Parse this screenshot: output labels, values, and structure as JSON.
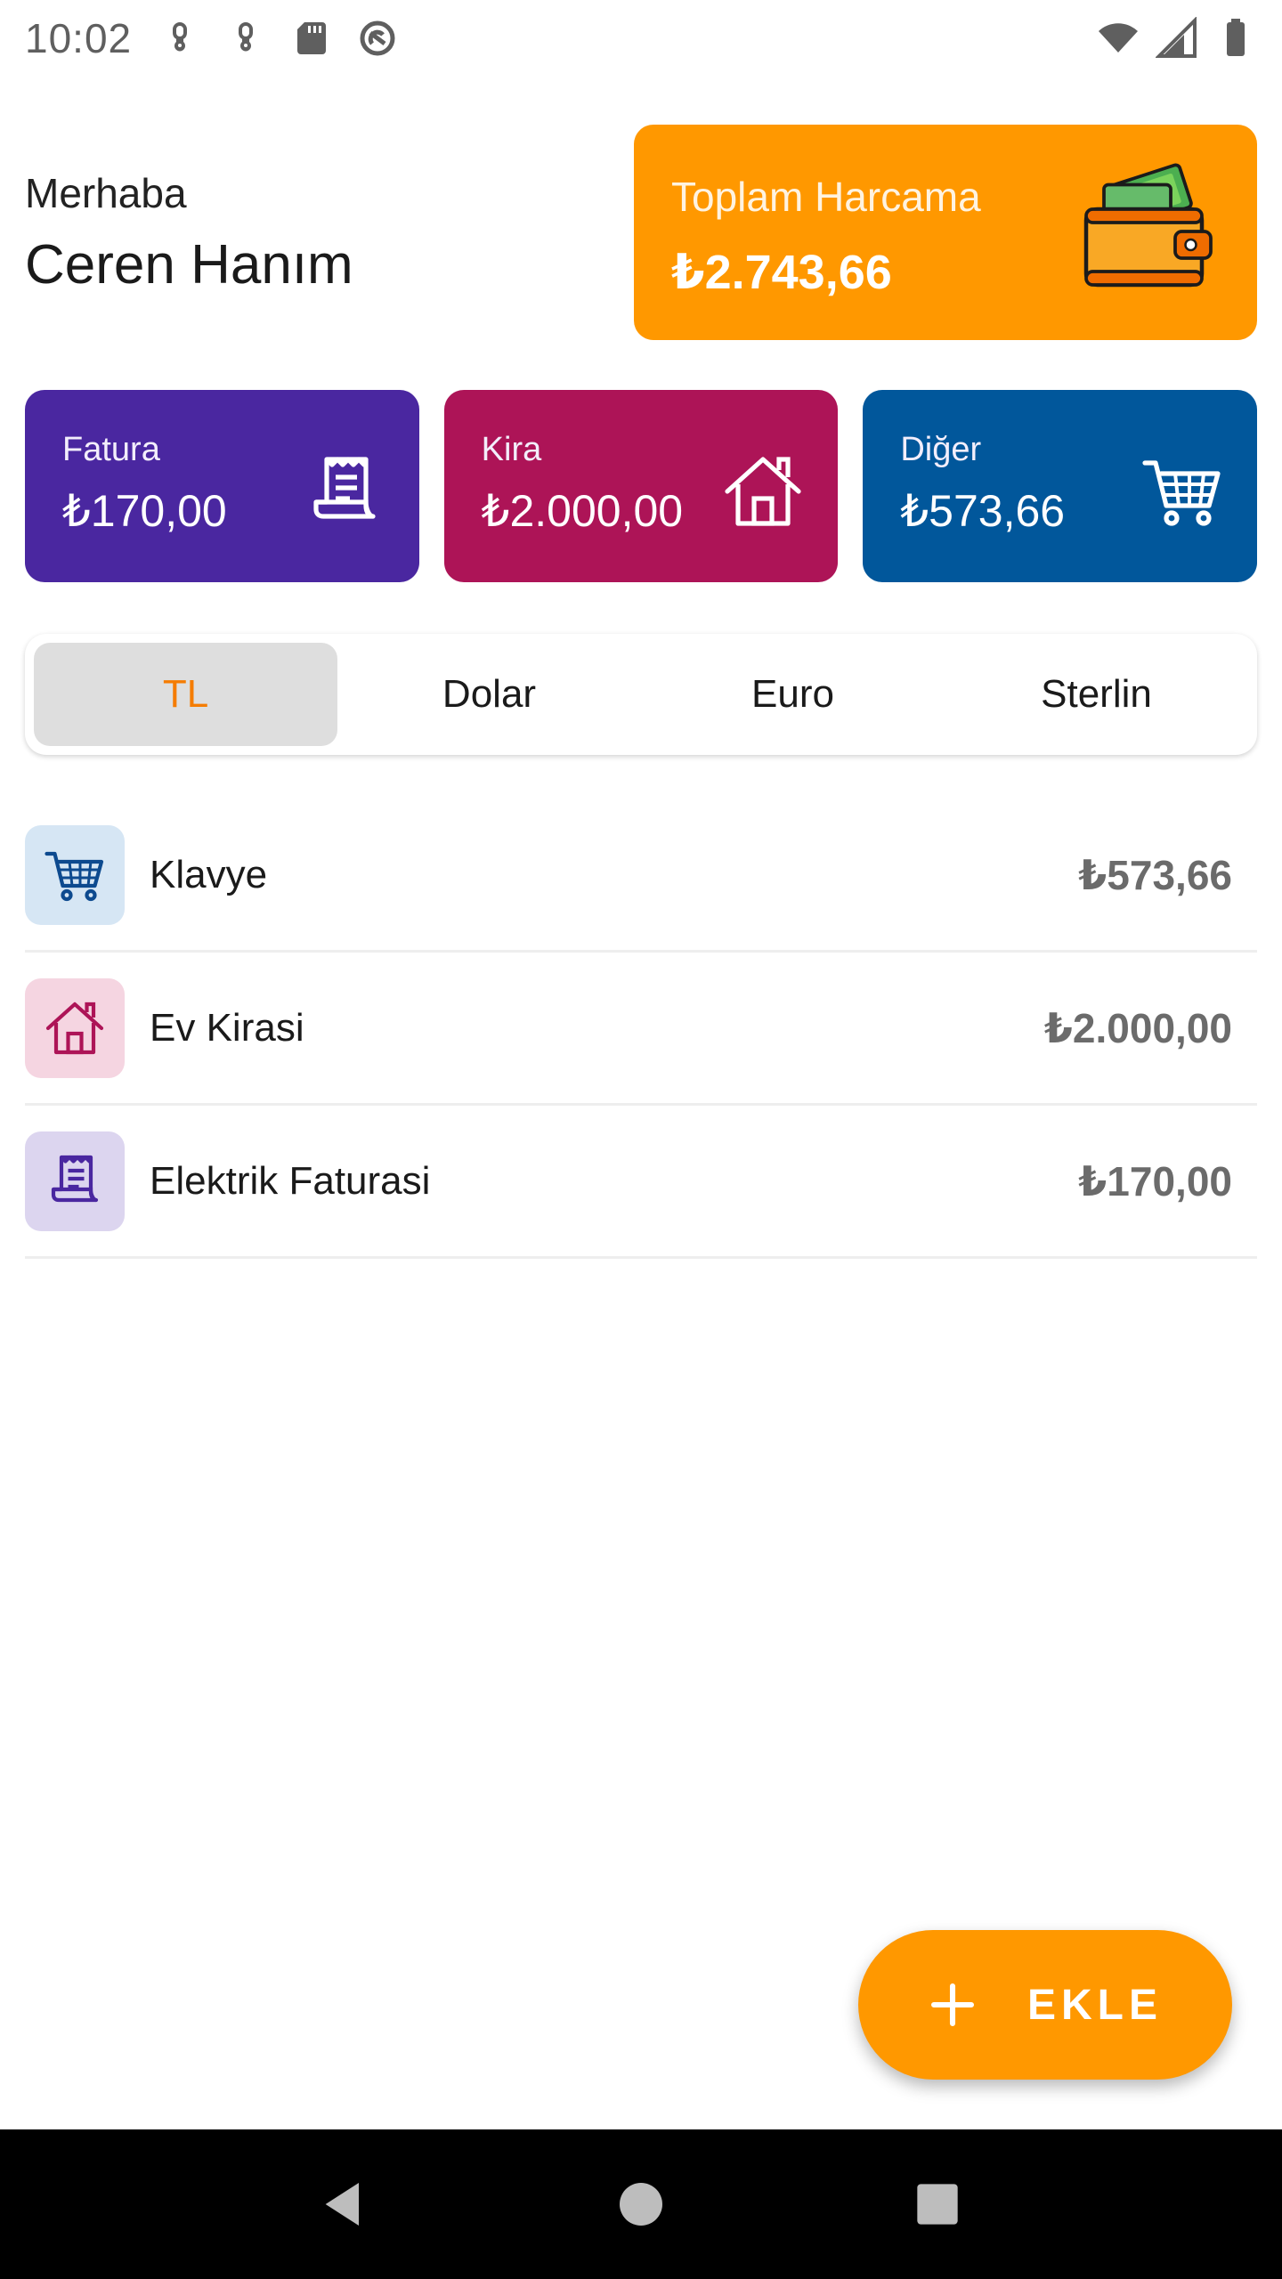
{
  "status_bar": {
    "time": "10:02",
    "icons": [
      "link-icon",
      "link-icon",
      "sd-card-icon",
      "sync-icon"
    ],
    "right_icons": [
      "wifi-icon",
      "signal-icon",
      "battery-icon"
    ]
  },
  "header": {
    "greeting": "Merhaba",
    "name": "Ceren Hanım"
  },
  "total_card": {
    "title": "Toplam Harcama",
    "value": "₺2.743,66",
    "icon": "wallet-icon",
    "color": "#ff9800"
  },
  "categories": [
    {
      "label": "Fatura",
      "value": "₺170,00",
      "icon": "receipt-icon",
      "color": "#4a27a0"
    },
    {
      "label": "Kira",
      "value": "₺2.000,00",
      "icon": "house-icon",
      "color": "#ad1457"
    },
    {
      "label": "Diğer",
      "value": "₺573,66",
      "icon": "cart-icon",
      "color": "#01579b"
    }
  ],
  "currency_tabs": {
    "items": [
      "TL",
      "Dolar",
      "Euro",
      "Sterlin"
    ],
    "selected": "TL",
    "accent": "#f57c00"
  },
  "expenses": [
    {
      "name": "Klavye",
      "amount": "₺573,66",
      "icon": "cart-icon"
    },
    {
      "name": "Ev Kirasi",
      "amount": "₺2.000,00",
      "icon": "house-icon"
    },
    {
      "name": "Elektrik Faturasi",
      "amount": "₺170,00",
      "icon": "receipt-icon"
    }
  ],
  "fab": {
    "label": "EKLE",
    "icon": "plus-icon"
  },
  "nav_bar": {
    "buttons": [
      "back-icon",
      "home-icon",
      "recents-icon"
    ]
  }
}
